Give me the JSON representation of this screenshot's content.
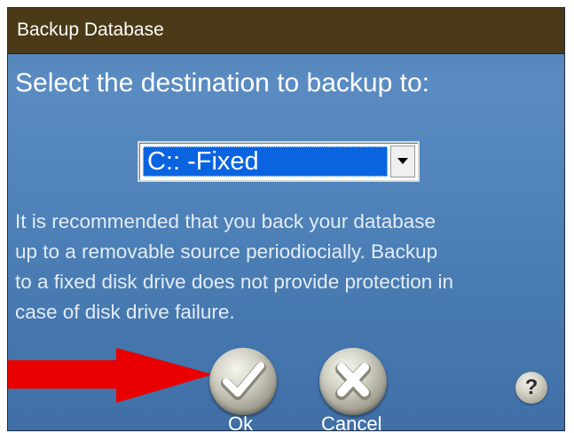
{
  "window": {
    "title": "Backup Database"
  },
  "dialog": {
    "heading": "Select the destination to backup to:",
    "destination": {
      "selected_value": "C:: -Fixed"
    },
    "warning_lines": [
      "It is recommended that you back your database",
      "up to a removable source periodiocially.  Backup",
      "to a fixed disk drive does not provide protection in",
      "case of disk drive failure."
    ]
  },
  "buttons": {
    "ok_label": "Ok",
    "cancel_label": "Cancel",
    "help_glyph": "?"
  },
  "icons": {
    "ok": "checkmark-icon",
    "cancel": "x-icon",
    "help": "question-mark-icon",
    "dropdown": "chevron-down-icon",
    "annotation": "red-arrow-icon"
  },
  "colors": {
    "titlebar": "#4a3a17",
    "dialog_background": "#4f7eb0",
    "selection": "#0a64e0",
    "annotation_arrow": "#e80000"
  }
}
